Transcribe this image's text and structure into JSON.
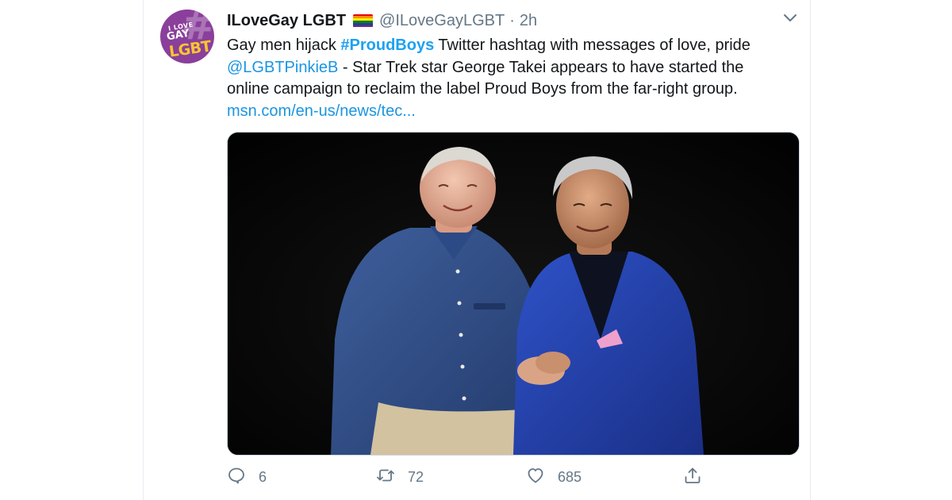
{
  "tweet": {
    "display_name": "ILoveGay LGBT",
    "handle": "@ILoveGayLGBT",
    "separator": "·",
    "time": "2h",
    "avatar": {
      "text_line1": "I LOVE",
      "text_line2": "GAY",
      "text_line3": "LGBT",
      "hash_mark": "#",
      "bg_color": "#8a3f9a",
      "accent_color": "#f7c530"
    },
    "flag_icon": "rainbow-flag-emoji",
    "flag_colors": [
      "#e40303",
      "#ff8c00",
      "#ffed00",
      "#008026",
      "#24408e",
      "#732982"
    ],
    "body": {
      "line1_prefix": "Gay men hijack ",
      "hashtag": "#ProudBoys",
      "line1_suffix": " Twitter hashtag with messages of love, pride",
      "mention": "@LGBTPinkieB",
      "line2_suffix": " - Star Trek star George Takei appears to have started the",
      "line3": "online campaign to reclaim the label Proud Boys from the far-right group.",
      "link": "msn.com/en-us/news/tec..."
    },
    "menu_icon": "chevron-down-icon",
    "actions": {
      "reply_icon": "reply-icon",
      "reply_count": "6",
      "retweet_icon": "retweet-icon",
      "retweet_count": "72",
      "like_icon": "heart-icon",
      "like_count": "685",
      "share_icon": "share-icon"
    },
    "colors": {
      "link": "#1b95e0",
      "hashtag": "#1da1f2",
      "text": "#14171a",
      "muted": "#657786"
    }
  }
}
